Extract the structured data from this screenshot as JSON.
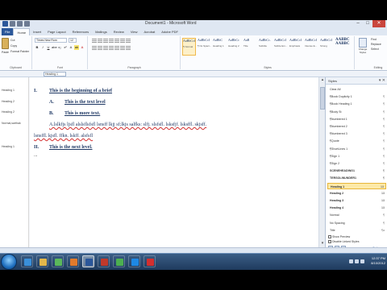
{
  "window": {
    "title": "Document1 - Microsoft Word",
    "controls": [
      "–",
      "□",
      "✕"
    ],
    "qat_icons": [
      "word-icon",
      "save-icon",
      "undo-icon",
      "redo-icon"
    ]
  },
  "ribbon": {
    "tabs": [
      "File",
      "Home",
      "Insert",
      "Page Layout",
      "References",
      "Mailings",
      "Review",
      "View",
      "Acrobat",
      "Adobe PDF"
    ],
    "active_tab": "Home",
    "clipboard": {
      "paste_label": "Paste",
      "cut": "Cut",
      "copy": "Copy",
      "format_painter": "Format Painter",
      "group_label": "Clipboard"
    },
    "font": {
      "name": "Times New Rom",
      "size": "12",
      "group_label": "Font",
      "buttons": [
        "B",
        "I",
        "U",
        "abe",
        "x₂",
        "x²",
        "A",
        "ab",
        "A"
      ]
    },
    "paragraph": {
      "group_label": "Paragraph"
    },
    "styles": {
      "group_label": "Styles",
      "tiles": [
        {
          "preview": "AaBbCcI",
          "name": "¶ Normal"
        },
        {
          "preview": "AaBbCcI",
          "name": "¶ No Spaci..."
        },
        {
          "preview": "AaBbC",
          "name": "Heading 1"
        },
        {
          "preview": "AaBbCc",
          "name": "Heading 2"
        },
        {
          "preview": "AaB",
          "name": "Title"
        },
        {
          "preview": "AaBbCc.",
          "name": "Subtitle"
        },
        {
          "preview": "AaBbCcI",
          "name": "Subtle Em..."
        },
        {
          "preview": "AaBbCcI",
          "name": "Emphasis"
        },
        {
          "preview": "AaBbCcI",
          "name": "Intense E..."
        },
        {
          "preview": "AaBbCcI",
          "name": "Strong"
        }
      ],
      "big_tiles": [
        "AABBC",
        "AABBC"
      ],
      "change_styles": "Change Styles"
    },
    "editing": {
      "find": "Find",
      "replace": "Replace",
      "select": "Select",
      "group_label": "Editing"
    }
  },
  "nav_pane": {
    "search_value": "Heading 1"
  },
  "style_area": {
    "labels": [
      "Heading 1",
      "Heading 2",
      "Heading 2",
      "Normal,sarthak",
      "Heading 1"
    ]
  },
  "document": {
    "lines": [
      {
        "num": "I.",
        "text": "This is the beginning of a brief"
      },
      {
        "num": "A.",
        "text": "This is the text level"
      },
      {
        "num": "B.",
        "text": "This is more text."
      },
      {
        "num": "",
        "text": "A.lslkfjs ljsfl alslsflsfsfl lsnsff lkjj sf;lkjs salfks: slfj. slsfsfl. lsksfjf. lsksffl. skjsff."
      },
      {
        "num": "",
        "text": "lsnsffl. kjsfl. ffkn. lskff. alsfsfl"
      },
      {
        "num": "II.",
        "text": "This is the next level."
      },
      {
        "num": "",
        "text": "..."
      }
    ]
  },
  "styles_pane": {
    "title": "Styles",
    "close": "▾ ✕",
    "items": [
      {
        "name": "Clear All",
        "mark": ""
      },
      {
        "name": "¶Book Duplicity 1",
        "mark": "¶"
      },
      {
        "name": "¶Book Heading 1",
        "mark": "¶"
      },
      {
        "name": "¶Body St",
        "mark": "¶"
      },
      {
        "name": "¶Numbered 1",
        "mark": "¶"
      },
      {
        "name": "¶Numbered 2",
        "mark": "¶"
      },
      {
        "name": "¶Numbered 3",
        "mark": "¶"
      },
      {
        "name": "¶Quote",
        "mark": "¶"
      },
      {
        "name": "¶ShortLines 1",
        "mark": "¶"
      },
      {
        "name": "¶Sign 1",
        "mark": "¶"
      },
      {
        "name": "¶Sign 2",
        "mark": "¶"
      },
      {
        "name": "SCENEHEADING1",
        "mark": "¶"
      },
      {
        "name": "TERSOLINUNDER1",
        "mark": "¶"
      },
      {
        "name": "Heading 1",
        "mark": "13"
      },
      {
        "name": "Heading 2",
        "mark": "13"
      },
      {
        "name": "Heading 3",
        "mark": "13"
      },
      {
        "name": "Heading 4",
        "mark": "13"
      },
      {
        "name": "Normal",
        "mark": "¶"
      },
      {
        "name": "No Spacing",
        "mark": "¶"
      },
      {
        "name": "Title",
        "mark": "¶a"
      }
    ],
    "show_preview": "Show Preview",
    "disable_linked": "Disable Linked Styles",
    "options": "Options..."
  },
  "taskbar": {
    "apps": [
      "ie-icon",
      "explorer-icon",
      "media-icon",
      "firefox-icon",
      "word-icon",
      "calendar-icon",
      "chrome-icon",
      "lync-icon",
      "acrobat-icon"
    ],
    "time": "12:37 PM",
    "date": "8/10/2012"
  }
}
